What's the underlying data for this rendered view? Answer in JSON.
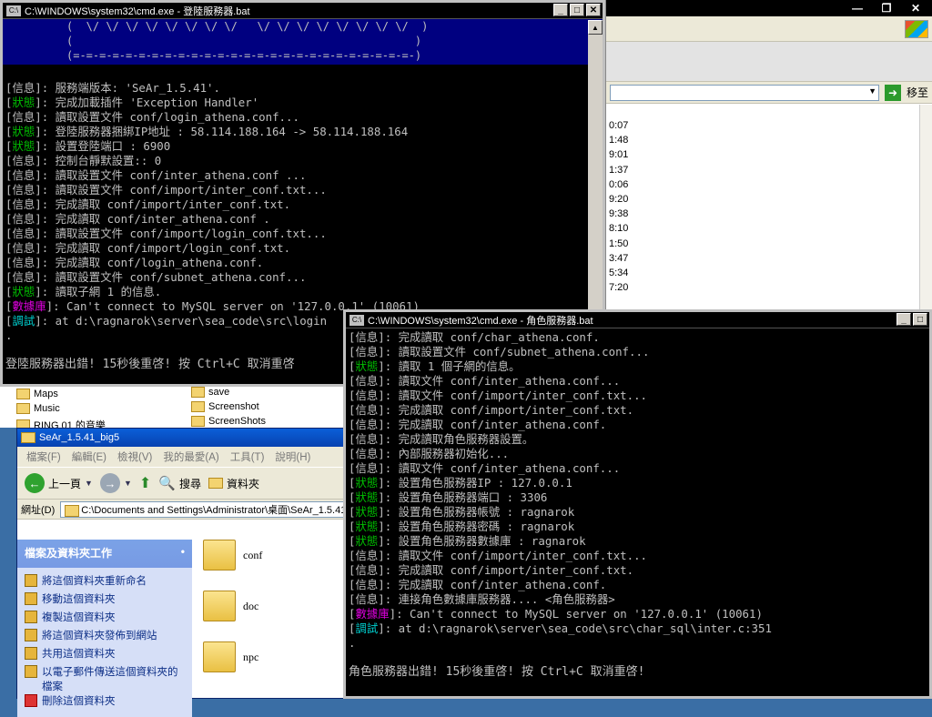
{
  "bg_window": {
    "controls": [
      "—",
      "❐",
      "✕"
    ],
    "go_label": "移至",
    "times": [
      "0:07",
      "1:48",
      "9:01",
      "1:37",
      "0:06",
      "9:20",
      "9:38",
      "8:10",
      "1:50",
      "3:47",
      "5:34",
      "7:20"
    ]
  },
  "folder_strip": {
    "items": [
      "Maps",
      "Music",
      "RING 01 的音樂",
      "save",
      "Screenshot",
      "ScreenShots"
    ]
  },
  "explorer": {
    "title": "SeAr_1.5.41_big5",
    "menu": [
      "檔案(F)",
      "編輯(E)",
      "檢視(V)",
      "我的最愛(A)",
      "工具(T)",
      "說明(H)"
    ],
    "back_label": "上一頁",
    "search_label": "搜尋",
    "folders_label": "資料夾",
    "address_label": "網址(D)",
    "address_value": "C:\\Documents and Settings\\Administrator\\桌面\\SeAr_1.5.41_",
    "task_header": "檔案及資料夾工作",
    "tasks": [
      "將這個資料夾重新命名",
      "移動這個資料夾",
      "複製這個資料夾",
      "將這個資料夾發佈到網站",
      "共用這個資料夾",
      "以電子郵件傳送這個資料夾的檔案",
      "刪除這個資料夾"
    ],
    "files": [
      "conf",
      "doc",
      "npc"
    ]
  },
  "login_console": {
    "title": "C:\\WINDOWS\\system32\\cmd.exe - 登陸服務器.bat",
    "banner": [
      "(  \\/ \\/ \\/ \\/ \\/ \\/ \\/ \\/   \\/ \\/ \\/ \\/ \\/ \\/ \\/ \\/  )",
      "(                                                    )",
      "(=-=-=-=-=-=-=-=-=-=-=-=-=-=-=-=-=-=-=-=-=-=-=-=-=-=-)"
    ],
    "lines": [
      {
        "tag": "信息",
        "cls": "tag-info",
        "text": "服務端版本: 'SeAr_1.5.41'."
      },
      {
        "tag": "狀態",
        "cls": "tag-status",
        "text": "完成加載插件 'Exception Handler'"
      },
      {
        "tag": "信息",
        "cls": "tag-info",
        "text": "讀取設置文件 conf/login_athena.conf..."
      },
      {
        "tag": "狀態",
        "cls": "tag-status",
        "text": "登陸服務器捆綁IP地址 : 58.114.188.164 -> 58.114.188.164"
      },
      {
        "tag": "狀態",
        "cls": "tag-status",
        "text": "設置登陸端口 : 6900"
      },
      {
        "tag": "信息",
        "cls": "tag-info",
        "text": "控制台靜默設置:: 0"
      },
      {
        "tag": "信息",
        "cls": "tag-info",
        "text": "讀取設置文件 conf/inter_athena.conf ..."
      },
      {
        "tag": "信息",
        "cls": "tag-info",
        "text": "讀取設置文件 conf/import/inter_conf.txt..."
      },
      {
        "tag": "信息",
        "cls": "tag-info",
        "text": "完成讀取 conf/import/inter_conf.txt."
      },
      {
        "tag": "信息",
        "cls": "tag-info",
        "text": "完成讀取 conf/inter_athena.conf ."
      },
      {
        "tag": "信息",
        "cls": "tag-info",
        "text": "讀取設置文件 conf/import/login_conf.txt..."
      },
      {
        "tag": "信息",
        "cls": "tag-info",
        "text": "完成讀取 conf/import/login_conf.txt."
      },
      {
        "tag": "信息",
        "cls": "tag-info",
        "text": "完成讀取 conf/login_athena.conf."
      },
      {
        "tag": "信息",
        "cls": "tag-info",
        "text": "讀取設置文件 conf/subnet_athena.conf..."
      },
      {
        "tag": "狀態",
        "cls": "tag-status",
        "text": "讀取子網 1 的信息."
      },
      {
        "tag": "數據庫",
        "cls": "tag-db",
        "text": "Can't connect to MySQL server on '127.0.0.1' (10061)"
      },
      {
        "tag": "調試",
        "cls": "tag-debug",
        "text": "at d:\\ragnarok\\server\\sea_code\\src\\login"
      }
    ],
    "dot": ".",
    "footer": "登陸服務器出錯! 15秒後重啓! 按 Ctrl+C 取消重啓"
  },
  "char_console": {
    "title": "C:\\WINDOWS\\system32\\cmd.exe - 角色服務器.bat",
    "lines": [
      {
        "tag": "信息",
        "cls": "tag-info",
        "text": "完成讀取 conf/char_athena.conf."
      },
      {
        "tag": "信息",
        "cls": "tag-info",
        "text": "讀取設置文件 conf/subnet_athena.conf..."
      },
      {
        "tag": "狀態",
        "cls": "tag-status",
        "text": "讀取 1 個子網的信息。"
      },
      {
        "tag": "信息",
        "cls": "tag-info",
        "text": "讀取文件 conf/inter_athena.conf..."
      },
      {
        "tag": "信息",
        "cls": "tag-info",
        "text": "讀取文件 conf/import/inter_conf.txt..."
      },
      {
        "tag": "信息",
        "cls": "tag-info",
        "text": "完成讀取 conf/import/inter_conf.txt."
      },
      {
        "tag": "信息",
        "cls": "tag-info",
        "text": "完成讀取 conf/inter_athena.conf."
      },
      {
        "tag": "信息",
        "cls": "tag-info",
        "text": "完成讀取角色服務器設置。"
      },
      {
        "tag": "信息",
        "cls": "tag-info",
        "text": "內部服務器初始化..."
      },
      {
        "tag": "信息",
        "cls": "tag-info",
        "text": "讀取文件 conf/inter_athena.conf..."
      },
      {
        "tag": "狀態",
        "cls": "tag-status",
        "text": "設置角色服務器IP : 127.0.0.1"
      },
      {
        "tag": "狀態",
        "cls": "tag-status",
        "text": "設置角色服務器端口 : 3306"
      },
      {
        "tag": "狀態",
        "cls": "tag-status",
        "text": "設置角色服務器帳號 : ragnarok"
      },
      {
        "tag": "狀態",
        "cls": "tag-status",
        "text": "設置角色服務器密碼 : ragnarok"
      },
      {
        "tag": "狀態",
        "cls": "tag-status",
        "text": "設置角色服務器數據庫 : ragnarok"
      },
      {
        "tag": "信息",
        "cls": "tag-info",
        "text": "讀取文件 conf/import/inter_conf.txt..."
      },
      {
        "tag": "信息",
        "cls": "tag-info",
        "text": "完成讀取 conf/import/inter_conf.txt."
      },
      {
        "tag": "信息",
        "cls": "tag-info",
        "text": "完成讀取 conf/inter_athena.conf."
      },
      {
        "tag": "信息",
        "cls": "tag-info",
        "text": "連接角色數據庫服務器.... <角色服務器>"
      },
      {
        "tag": "數據庫",
        "cls": "tag-db",
        "text": "Can't connect to MySQL server on '127.0.0.1' (10061)"
      },
      {
        "tag": "調試",
        "cls": "tag-debug",
        "text": "at d:\\ragnarok\\server\\sea_code\\src\\char_sql\\inter.c:351"
      }
    ],
    "dot": ".",
    "footer": "角色服務器出錯! 15秒後重啓! 按 Ctrl+C 取消重啓!"
  }
}
